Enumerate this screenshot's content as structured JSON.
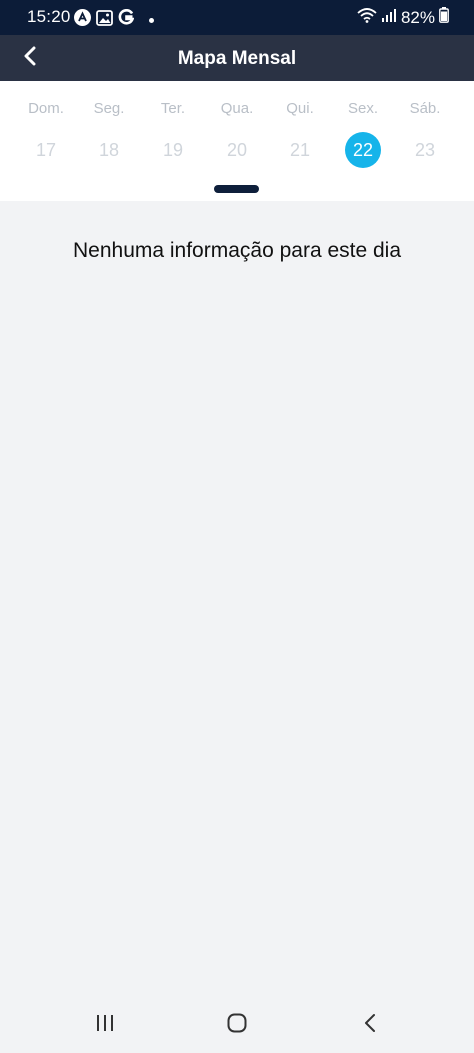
{
  "status_bar": {
    "time": "15:20",
    "battery": "82%",
    "icons_left": [
      "app-notification-icon",
      "gallery-icon",
      "google-icon",
      "more-notifications-dot"
    ],
    "icons_right": [
      "wifi-icon",
      "signal-icon",
      "battery-icon"
    ]
  },
  "header": {
    "title": "Mapa Mensal",
    "back_icon": "chevron-left-icon"
  },
  "week": {
    "days": [
      {
        "name": "Dom.",
        "num": "17",
        "selected": false
      },
      {
        "name": "Seg.",
        "num": "18",
        "selected": false
      },
      {
        "name": "Ter.",
        "num": "19",
        "selected": false
      },
      {
        "name": "Qua.",
        "num": "20",
        "selected": false
      },
      {
        "name": "Qui.",
        "num": "21",
        "selected": false
      },
      {
        "name": "Sex.",
        "num": "22",
        "selected": true
      },
      {
        "name": "Sáb.",
        "num": "23",
        "selected": false
      }
    ]
  },
  "content": {
    "empty_message": "Nenhuma informação para este dia"
  },
  "colors": {
    "status_bar_bg": "#0c1c38",
    "header_bg": "#2a3244",
    "selected_day": "#16b4ea",
    "handle": "#0e1f3b"
  },
  "nav_bar": {
    "buttons": [
      "recent-apps-icon",
      "home-icon",
      "back-icon"
    ]
  }
}
